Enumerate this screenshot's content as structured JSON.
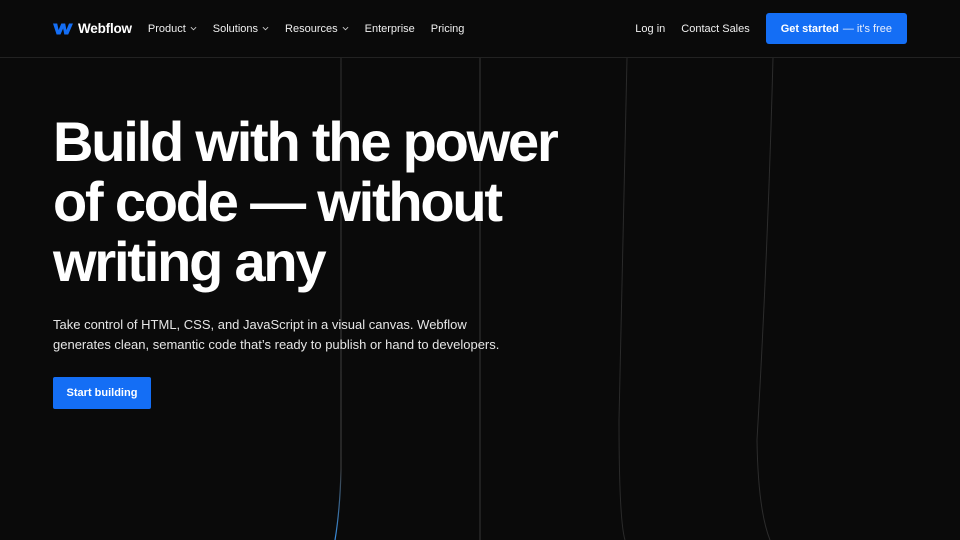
{
  "brand": {
    "name": "Webflow",
    "logo_icon": "webflow-w-logo",
    "accent_color": "#146ef5"
  },
  "header": {
    "nav": [
      {
        "label": "Product",
        "has_dropdown": true
      },
      {
        "label": "Solutions",
        "has_dropdown": true
      },
      {
        "label": "Resources",
        "has_dropdown": true
      },
      {
        "label": "Enterprise",
        "has_dropdown": false
      },
      {
        "label": "Pricing",
        "has_dropdown": false
      }
    ],
    "login_label": "Log in",
    "contact_label": "Contact Sales",
    "cta": {
      "label": "Get started",
      "sublabel": "— it's free"
    }
  },
  "hero": {
    "headline_lines": [
      "Build with the power",
      "of code — without",
      "writing any"
    ],
    "subtext": "Take control of HTML, CSS, and JavaScript in a visual canvas. Webflow generates clean, semantic code that’s ready to publish or hand to developers.",
    "primary_button_label": "Start building"
  },
  "colors": {
    "background": "#0a0a0a",
    "text": "#ffffff",
    "divider": "#222222",
    "line": "#2a2a2a",
    "line_glow": "#3a8fe0"
  }
}
